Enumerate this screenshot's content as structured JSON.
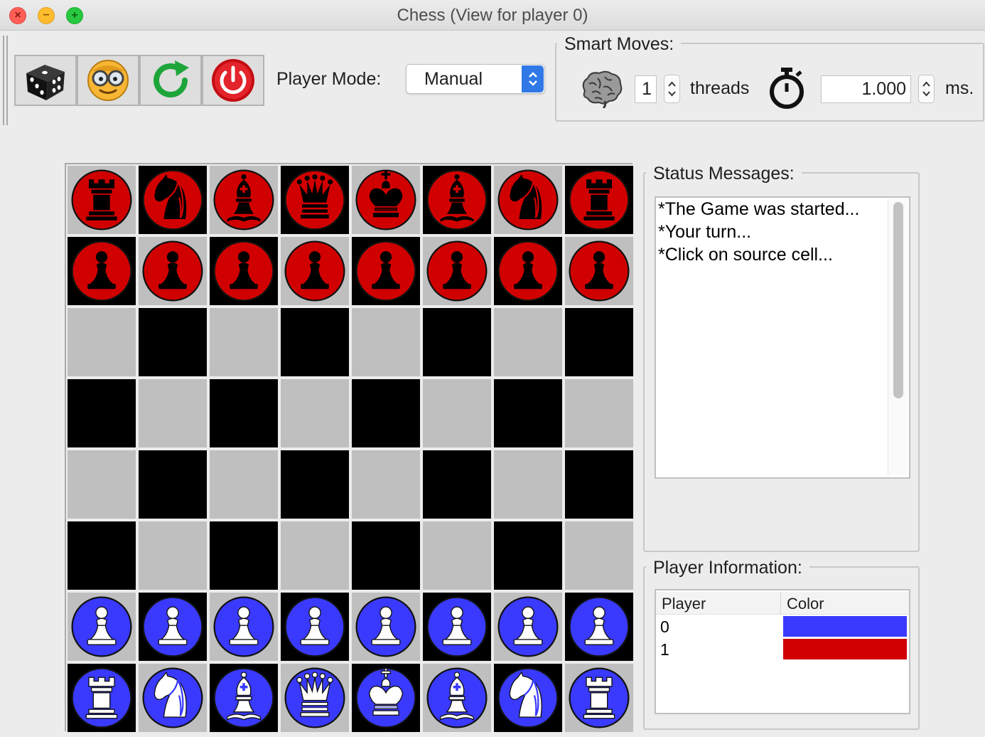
{
  "window": {
    "title": "Chess (View for player 0)"
  },
  "toolbar": {
    "buttons": [
      {
        "name": "random-move",
        "icon": "dice-icon"
      },
      {
        "name": "change-view",
        "icon": "smiley-glasses-icon"
      },
      {
        "name": "restart",
        "icon": "restart-icon"
      },
      {
        "name": "exit",
        "icon": "power-icon"
      }
    ],
    "player_mode_label": "Player Mode:",
    "player_mode_value": "Manual"
  },
  "smart_moves": {
    "title": "Smart Moves:",
    "threads_value": "1",
    "threads_label": "threads",
    "ms_value": "1.000",
    "ms_label": "ms.",
    "icons": [
      "brain-icon",
      "stopwatch-icon"
    ]
  },
  "board": {
    "size": 8,
    "top_left_shade": "light",
    "rows": [
      [
        "r",
        "n",
        "b",
        "q",
        "k",
        "b",
        "n",
        "r"
      ],
      [
        "p",
        "p",
        "p",
        "p",
        "p",
        "p",
        "p",
        "p"
      ],
      [
        "",
        "",
        "",
        "",
        "",
        "",
        "",
        ""
      ],
      [
        "",
        "",
        "",
        "",
        "",
        "",
        "",
        ""
      ],
      [
        "",
        "",
        "",
        "",
        "",
        "",
        "",
        ""
      ],
      [
        "",
        "",
        "",
        "",
        "",
        "",
        "",
        ""
      ],
      [
        "P",
        "P",
        "P",
        "P",
        "P",
        "P",
        "P",
        "P"
      ],
      [
        "R",
        "N",
        "B",
        "Q",
        "K",
        "B",
        "N",
        "R"
      ]
    ],
    "colors": {
      "light_square": "#bfbfbf",
      "dark_square": "#000000",
      "player0": "#3a3aff",
      "player1": "#d10000"
    }
  },
  "status": {
    "title": "Status Messages:",
    "messages": [
      "*The Game was started...",
      "*Your turn...",
      "*Click on source cell..."
    ]
  },
  "player_info": {
    "title": "Player Information:",
    "headers": [
      "Player",
      "Color"
    ],
    "rows": [
      {
        "player": "0",
        "color": "#3a3aff"
      },
      {
        "player": "1",
        "color": "#d10000"
      }
    ]
  }
}
